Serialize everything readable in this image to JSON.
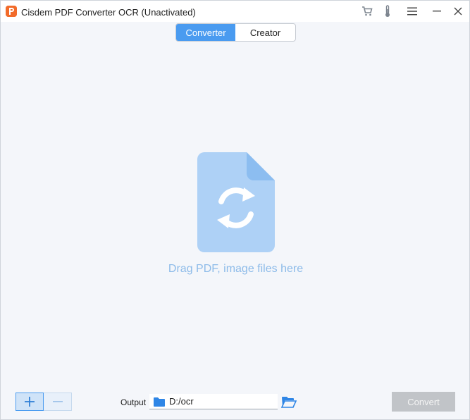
{
  "window": {
    "title": "Cisdem PDF Converter OCR (Unactivated)"
  },
  "titlebar_icons": [
    "cart-icon",
    "thermometer-icon",
    "hamburger-menu-icon",
    "minimize-icon",
    "close-icon"
  ],
  "tabs": [
    {
      "label": "Converter",
      "active": true
    },
    {
      "label": "Creator",
      "active": false
    }
  ],
  "dropzone": {
    "hint": "Drag PDF, image files here",
    "icon": "document-sync-icon"
  },
  "bottombar": {
    "add_icon": "plus-icon",
    "remove_icon": "minus-icon",
    "output_label": "Output",
    "output_path": "D:/ocr",
    "browse_icon": "open-folder-icon",
    "convert_label": "Convert"
  },
  "colors": {
    "accent": "#4a9bf0",
    "hint_text": "#8dbbe9",
    "file_icon": "#aed1f6",
    "convert_disabled": "#c1c4c8"
  }
}
